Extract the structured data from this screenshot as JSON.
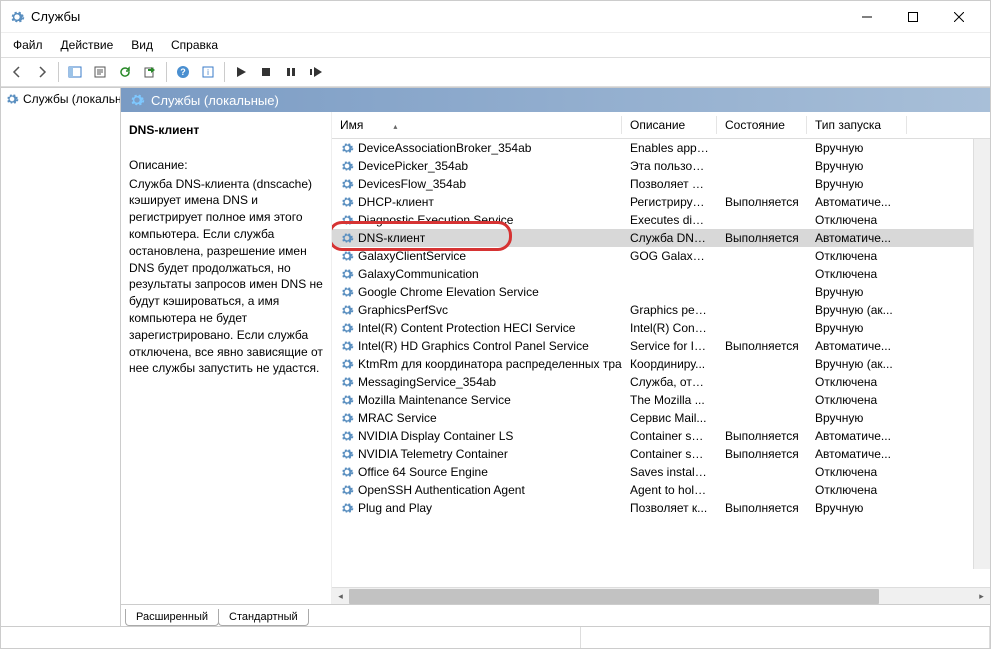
{
  "window": {
    "title": "Службы"
  },
  "menus": {
    "file": "Файл",
    "action": "Действие",
    "view": "Вид",
    "help": "Справка"
  },
  "tree": {
    "root": "Службы (локальн"
  },
  "content": {
    "header": "Службы (локальные)"
  },
  "detail": {
    "selected_title": "DNS-клиент",
    "desc_label": "Описание:",
    "desc_text": "Служба DNS-клиента (dnscache) кэширует имена DNS и регистрирует полное имя этого компьютера. Если служба остановлена, разрешение имен DNS будет продолжаться, но результаты запросов имен DNS не будут кэшироваться, а имя компьютера не будет зарегистрировано. Если служба отключена, все явно зависящие от нее службы запустить не удастся."
  },
  "columns": {
    "name": "Имя",
    "desc": "Описание",
    "state": "Состояние",
    "start": "Тип запуска"
  },
  "services": [
    {
      "name": "DeviceAssociationBroker_354ab",
      "desc": "Enables apps ...",
      "state": "",
      "start": "Вручную"
    },
    {
      "name": "DevicePicker_354ab",
      "desc": "Эта пользова...",
      "state": "",
      "start": "Вручную"
    },
    {
      "name": "DevicesFlow_354ab",
      "desc": "Позволяет ф...",
      "state": "",
      "start": "Вручную"
    },
    {
      "name": "DHCP-клиент",
      "desc": "Регистрируе...",
      "state": "Выполняется",
      "start": "Автоматиче..."
    },
    {
      "name": "Diagnostic Execution Service",
      "desc": "Executes diag...",
      "state": "",
      "start": "Отключена",
      "partially_hidden": true
    },
    {
      "name": "DNS-клиент",
      "desc": "Служба DNS...",
      "state": "Выполняется",
      "start": "Автоматиче...",
      "selected": true
    },
    {
      "name": "GalaxyClientService",
      "desc": "GOG Galaxy c...",
      "state": "",
      "start": "Отключена"
    },
    {
      "name": "GalaxyCommunication",
      "desc": "",
      "state": "",
      "start": "Отключена"
    },
    {
      "name": "Google Chrome Elevation Service",
      "desc": "",
      "state": "",
      "start": "Вручную"
    },
    {
      "name": "GraphicsPerfSvc",
      "desc": "Graphics perf...",
      "state": "",
      "start": "Вручную (ак..."
    },
    {
      "name": "Intel(R) Content Protection HECI Service",
      "desc": "Intel(R) Conte...",
      "state": "",
      "start": "Вручную"
    },
    {
      "name": "Intel(R) HD Graphics Control Panel Service",
      "desc": "Service for Int...",
      "state": "Выполняется",
      "start": "Автоматиче..."
    },
    {
      "name": "KtmRm для координатора распределенных тра...",
      "desc": "Координиру...",
      "state": "",
      "start": "Вручную (ак..."
    },
    {
      "name": "MessagingService_354ab",
      "desc": "Служба, отве...",
      "state": "",
      "start": "Отключена"
    },
    {
      "name": "Mozilla Maintenance Service",
      "desc": "The Mozilla ...",
      "state": "",
      "start": "Отключена"
    },
    {
      "name": "MRAC Service",
      "desc": "Сервис Mail...",
      "state": "",
      "start": "Вручную"
    },
    {
      "name": "NVIDIA Display Container LS",
      "desc": "Container ser...",
      "state": "Выполняется",
      "start": "Автоматиче..."
    },
    {
      "name": "NVIDIA Telemetry Container",
      "desc": "Container ser...",
      "state": "Выполняется",
      "start": "Автоматиче..."
    },
    {
      "name": "Office 64 Source Engine",
      "desc": "Saves installat...",
      "state": "",
      "start": "Отключена"
    },
    {
      "name": "OpenSSH Authentication Agent",
      "desc": "Agent to hold...",
      "state": "",
      "start": "Отключена"
    },
    {
      "name": "Plug and Play",
      "desc": "Позволяет к...",
      "state": "Выполняется",
      "start": "Вручную"
    }
  ],
  "tabs": {
    "extended": "Расширенный",
    "standard": "Стандартный"
  }
}
